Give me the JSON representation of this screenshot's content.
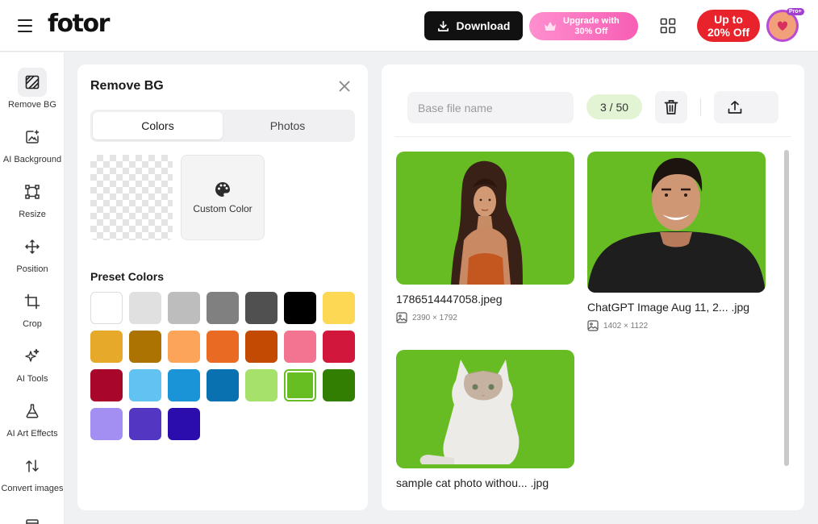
{
  "topbar": {
    "logo": "fotor",
    "download_label": "Download",
    "upgrade_line1": "Upgrade with",
    "upgrade_line2": "30% Off",
    "promo_line1": "Up to",
    "promo_line2": "20% Off",
    "pro_badge": "Pro+"
  },
  "sidebar": {
    "items": [
      {
        "label": "Remove BG",
        "icon": "remove-bg-icon"
      },
      {
        "label": "AI Background",
        "icon": "ai-background-icon"
      },
      {
        "label": "Resize",
        "icon": "resize-icon"
      },
      {
        "label": "Position",
        "icon": "position-icon"
      },
      {
        "label": "Crop",
        "icon": "crop-icon"
      },
      {
        "label": "AI Tools",
        "icon": "ai-tools-icon"
      },
      {
        "label": "AI Art Effects",
        "icon": "ai-art-effects-icon"
      },
      {
        "label": "Convert images",
        "icon": "convert-images-icon"
      }
    ]
  },
  "panel": {
    "title": "Remove BG",
    "tabs": [
      "Colors",
      "Photos"
    ],
    "active_tab": "Colors",
    "custom_color_label": "Custom Color",
    "preset_title": "Preset Colors",
    "presets": [
      "#ffffff",
      "#e0e0e0",
      "#bdbdbd",
      "#808080",
      "#505050",
      "#000000",
      "#fdd855",
      "#e6a92a",
      "#ac7303",
      "#fca55a",
      "#e86a23",
      "#c24a02",
      "#f37491",
      "#d2173d",
      "#a8062a",
      "#62c2f2",
      "#1b93d7",
      "#0a71b1",
      "#a5e16b",
      "#67be23",
      "#327e02",
      "#a28ff1",
      "#5336c2",
      "#2b0dad"
    ],
    "selected_color": "#67be23"
  },
  "files": {
    "base_placeholder": "Base file name",
    "counter": "3 / 50",
    "items": [
      {
        "name": "1786514447058.jpeg",
        "dims": "2390 × 1792"
      },
      {
        "name": "ChatGPT Image Aug 11, 2... .jpg",
        "dims": "1402 × 1122"
      },
      {
        "name": "sample cat photo withou... .jpg",
        "dims": ""
      }
    ]
  }
}
